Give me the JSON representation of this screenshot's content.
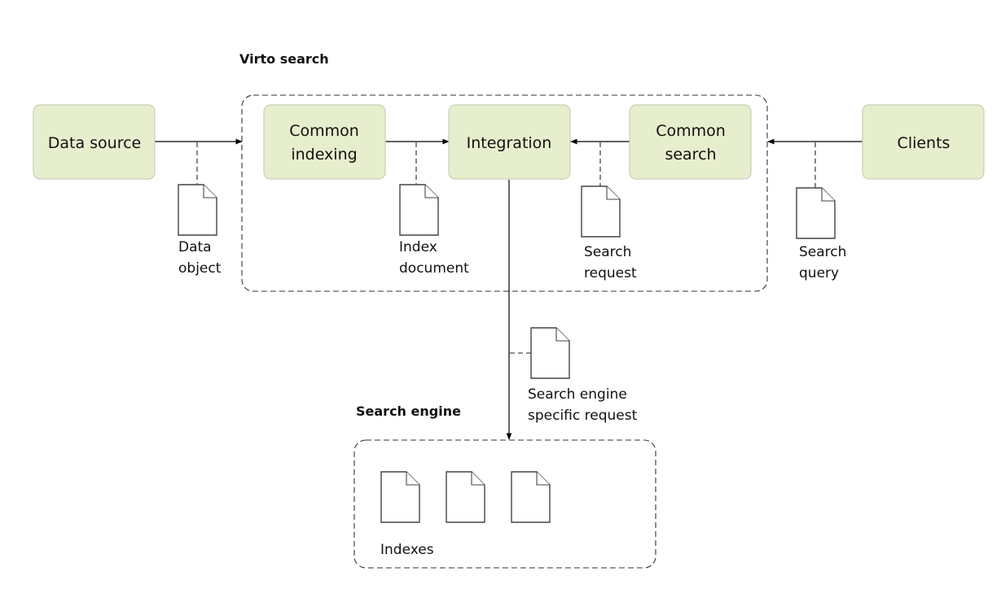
{
  "groups": {
    "virto": {
      "title": "Virto search"
    },
    "engine": {
      "title": "Search engine"
    }
  },
  "nodes": {
    "data_source": {
      "lines": [
        "Data source"
      ]
    },
    "common_indexing": {
      "lines": [
        "Common",
        "indexing"
      ]
    },
    "integration": {
      "lines": [
        "Integration"
      ]
    },
    "common_search": {
      "lines": [
        "Common",
        "search"
      ]
    },
    "clients": {
      "lines": [
        "Clients"
      ]
    }
  },
  "documents": {
    "data_object": {
      "lines": [
        "Data",
        "object"
      ]
    },
    "index_document": {
      "lines": [
        "Index",
        "document"
      ]
    },
    "search_request": {
      "lines": [
        "Search",
        "request"
      ]
    },
    "search_query": {
      "lines": [
        "Search",
        "query"
      ]
    },
    "engine_request": {
      "lines": [
        "Search engine",
        "specific request"
      ]
    },
    "indexes": {
      "label": "Indexes",
      "count": 3
    }
  },
  "colors": {
    "node_fill": "#e6eecd",
    "node_border": "#c7cfb2"
  }
}
